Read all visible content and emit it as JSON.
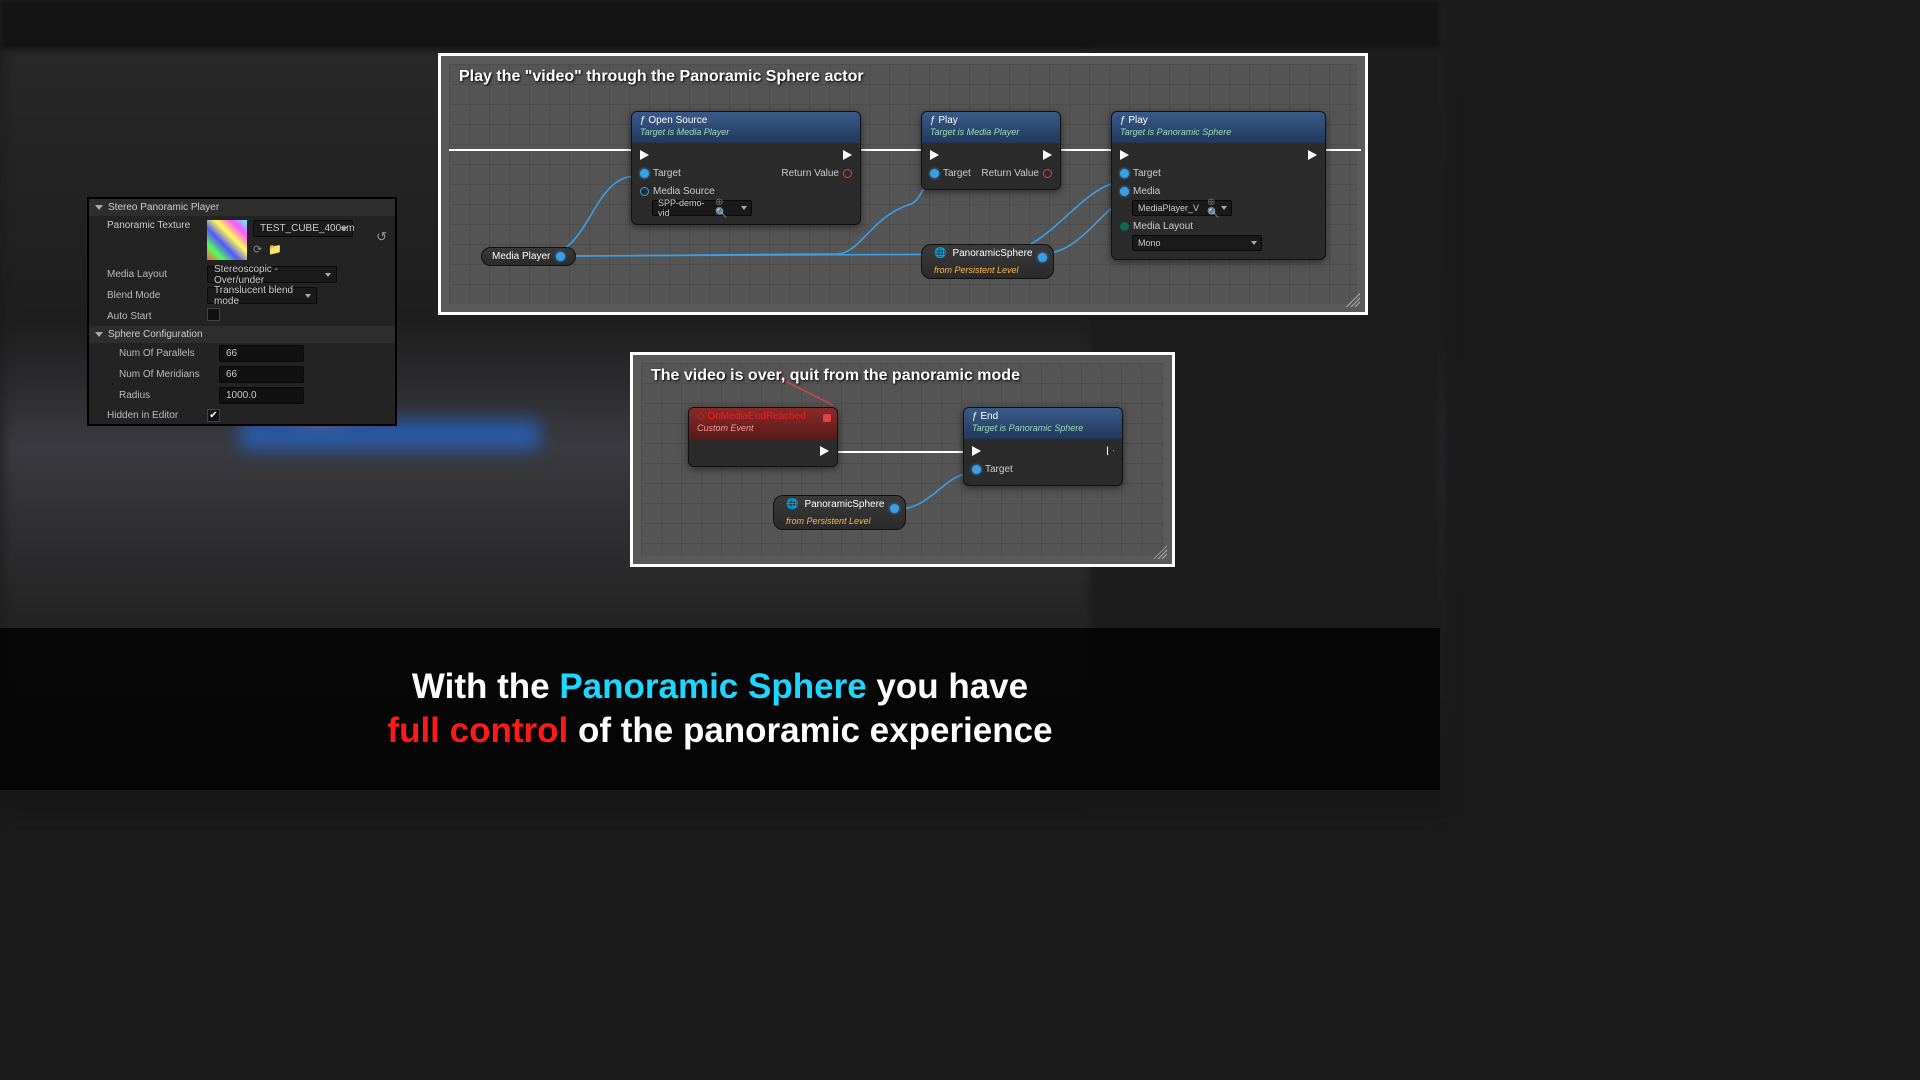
{
  "details": {
    "section1": "Stereo Panoramic Player",
    "tex_label": "Panoramic Texture",
    "tex_asset": "TEST_CUBE_400cm",
    "media_layout_label": "Media Layout",
    "media_layout_val": "Stereoscopic - Over/under",
    "blend_label": "Blend Mode",
    "blend_val": "Translucent blend mode",
    "auto_label": "Auto Start",
    "auto_checked": false,
    "section2": "Sphere Configuration",
    "parallels_label": "Num Of Parallels",
    "parallels_val": "66",
    "meridians_label": "Num Of Meridians",
    "meridians_val": "66",
    "radius_label": "Radius",
    "radius_val": "1000.0",
    "hidden_label": "Hidden in Editor",
    "hidden_checked": true
  },
  "graph1": {
    "title": "Play the \"video\" through the Panoramic Sphere actor",
    "var_media": "Media Player",
    "var_sphere": "PanoramicSphere",
    "var_sphere_sub": "from Persistent Level",
    "n1": {
      "title": "Open Source",
      "sub": "Target is Media Player",
      "pin_target": "Target",
      "pin_src": "Media Source",
      "src_val": "SPP-demo-vid",
      "pin_ret": "Return Value"
    },
    "n2": {
      "title": "Play",
      "sub": "Target is Media Player",
      "pin_target": "Target",
      "pin_ret": "Return Value"
    },
    "n3": {
      "title": "Play",
      "sub": "Target is Panoramic Sphere",
      "pin_target": "Target",
      "pin_media": "Media",
      "media_val": "MediaPlayer_V",
      "pin_layout": "Media Layout",
      "layout_val": "Mono"
    }
  },
  "graph2": {
    "title": "The video is over, quit from the panoramic mode",
    "var_sphere": "PanoramicSphere",
    "var_sphere_sub": "from Persistent Level",
    "evt": {
      "title": "OnMediaEndReached",
      "sub": "Custom Event"
    },
    "end": {
      "title": "End",
      "sub": "Target is Panoramic Sphere",
      "pin_target": "Target"
    }
  },
  "caption": {
    "l1a": "With the ",
    "l1b": "Panoramic Sphere",
    "l1c": " you have",
    "l2a": "full control",
    "l2b": " of the panoramic experience"
  }
}
